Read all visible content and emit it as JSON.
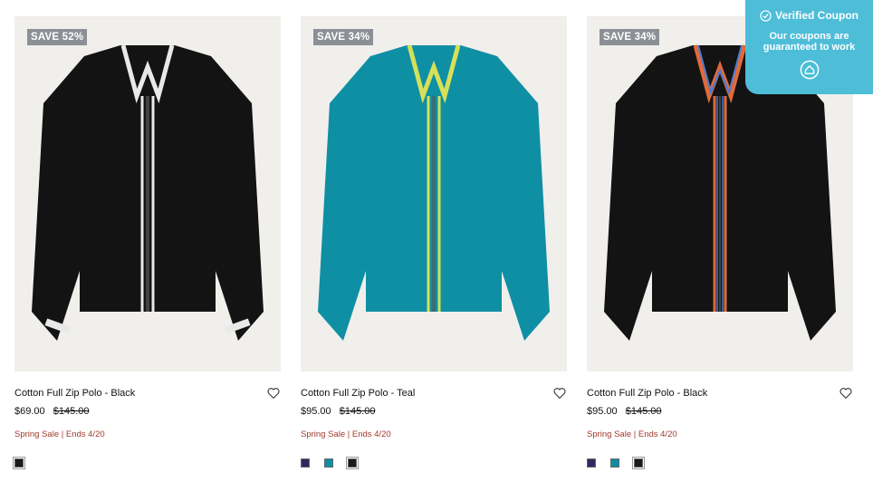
{
  "products": [
    {
      "badge": "SAVE 52%",
      "title": "Cotton Full Zip Polo - Black",
      "price_now": "$69.00",
      "price_was": "$145.00",
      "promo": "Spring Sale | Ends 4/20",
      "body_color": "#131313",
      "trim_color": "#e8e8e8",
      "swatches": [
        "#1a1a1a"
      ]
    },
    {
      "badge": "SAVE 34%",
      "title": "Cotton Full Zip Polo - Teal",
      "price_now": "$95.00",
      "price_was": "$145.00",
      "promo": "Spring Sale | Ends 4/20",
      "body_color": "#0f8fa3",
      "trim_color": "#d6e05a",
      "swatches": [
        "#2d2a5e",
        "#0f8fa3",
        "#1a1a1a"
      ]
    },
    {
      "badge": "SAVE 34%",
      "title": "Cotton Full Zip Polo - Black",
      "price_now": "$95.00",
      "price_was": "$145.00",
      "promo": "Spring Sale | Ends 4/20",
      "body_color": "#131313",
      "trim_color": "#e06a3a",
      "swatches": [
        "#2d2a5e",
        "#0f8fa3",
        "#1a1a1a"
      ]
    }
  ],
  "coupon": {
    "title": "Verified Coupon",
    "subtitle_line1": "Our coupons are",
    "subtitle_line2": "guaranteed to work",
    "icon": "shield-check-icon",
    "logo": "home-logo-icon"
  },
  "icons": {
    "wishlist": "heart-icon"
  }
}
